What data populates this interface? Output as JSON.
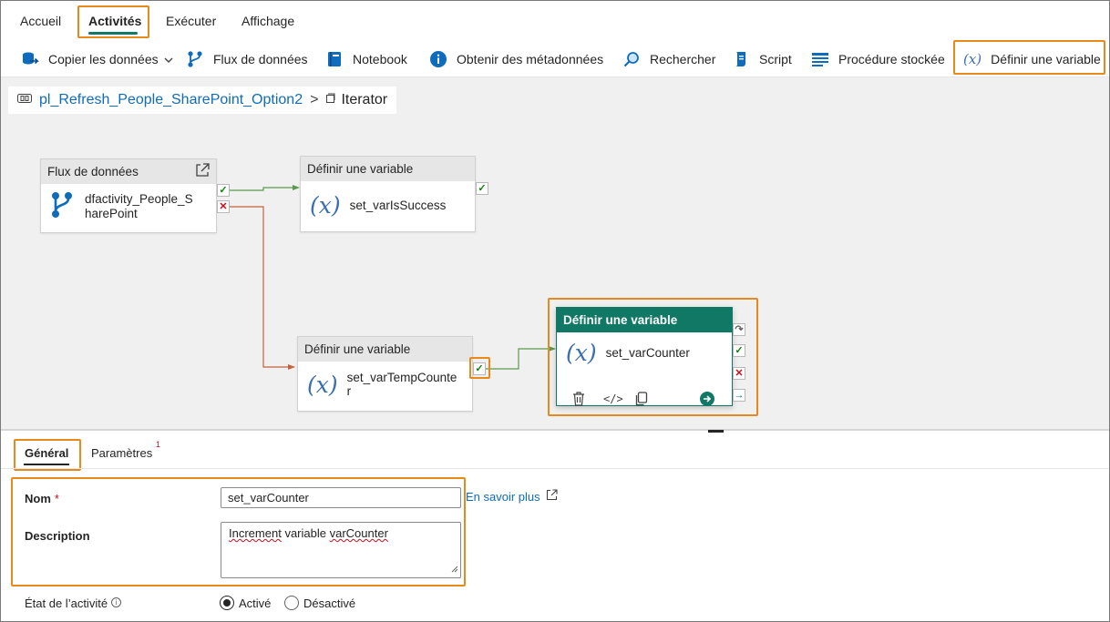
{
  "top_tabs": {
    "home": "Accueil",
    "activities": "Activités",
    "run": "Exécuter",
    "view": "Affichage"
  },
  "ribbon": {
    "copy_data": "Copier les données",
    "dataflow": "Flux de données",
    "notebook": "Notebook",
    "get_metadata": "Obtenir des métadonnées",
    "lookup": "Rechercher",
    "script": "Script",
    "stored_procedure": "Procédure stockée",
    "set_variable": "Définir une variable",
    "set_variable_icon_text": "(x)"
  },
  "breadcrumb": {
    "pipeline": "pl_Refresh_People_SharePoint_Option2",
    "separator": ">",
    "current": "Iterator"
  },
  "nodes": {
    "dataflow": {
      "header": "Flux de données",
      "name_line1": "dfactivity_People_S",
      "name_line2": "harePoint"
    },
    "set_success": {
      "header": "Définir une variable",
      "name": "set_varIsSuccess"
    },
    "set_temp": {
      "header": "Définir une variable",
      "name_line1": "set_varTempCounte",
      "name_line2": "r"
    },
    "set_counter": {
      "header": "Définir une variable",
      "name": "set_varCounter"
    },
    "variable_glyph": "(x)"
  },
  "properties": {
    "tabs": {
      "general": "Général",
      "parameters": "Paramètres",
      "parameters_badge": "1"
    },
    "name_label": "Nom",
    "required_mark": "*",
    "name_value": "set_varCounter",
    "learn_more": "En savoir plus",
    "description_label": "Description",
    "description_word1": "Increment",
    "description_word2": "variable",
    "description_word3": "varCounter",
    "state_label": "État de l’activité",
    "state_info": "i",
    "state_options": {
      "active": "Activé",
      "inactive": "Désactivé"
    },
    "state_selected": "active"
  },
  "colors": {
    "accent": "#117865",
    "highlight": "#e8891c",
    "success": "#107c10",
    "failure": "#c50f1f",
    "link": "#0f6cbd",
    "canvas_bg": "#f0f0f0"
  }
}
